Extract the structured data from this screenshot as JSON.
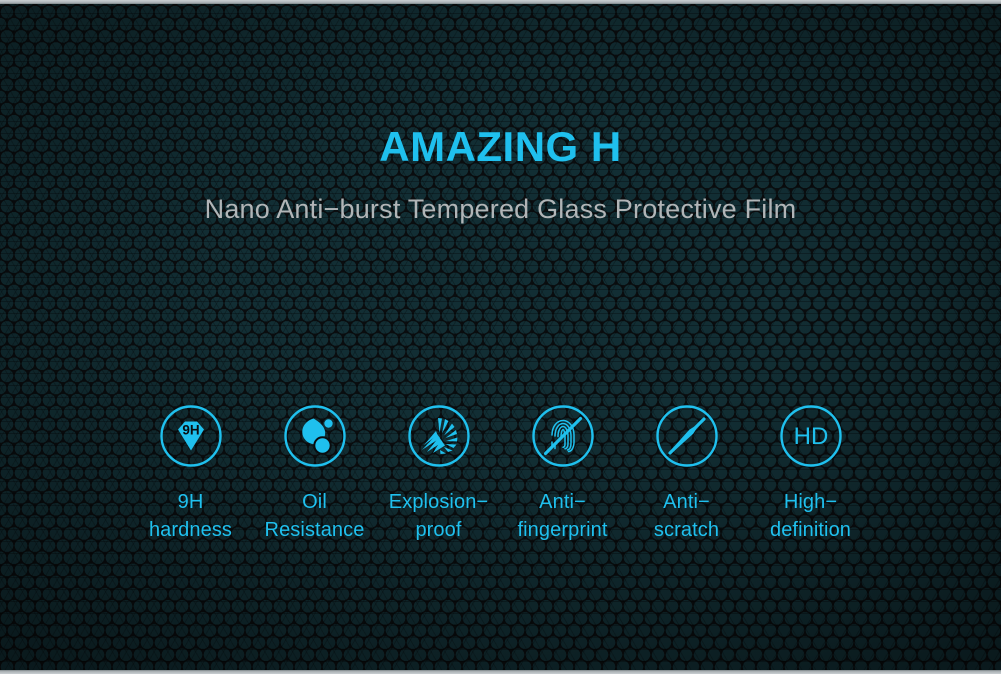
{
  "banner": {
    "headline": "AMAZING H",
    "subhead": "Nano Anti−burst\nTempered Glass Protective Film",
    "subhead_line1": "Nano Anti−burst",
    "subhead_line2": "Tempered Glass Protective Film",
    "colors": {
      "accent_cyan": "#1FC0EE",
      "subhead_gray": "#B1B5B7",
      "background_dark": "#0A0D0F",
      "hex_tint": "#123036",
      "edge_strip": "#AEB5B8"
    }
  },
  "features": [
    {
      "id": "hardness",
      "icon": "diamond-9h-icon",
      "icon_text": "9H",
      "label": "9H\nhardness",
      "label_line1": "9H",
      "label_line2": "hardness"
    },
    {
      "id": "oil-resistance",
      "icon": "oil-droplet-icon",
      "icon_text": "",
      "label": "Oil\nResistance",
      "label_line1": "Oil",
      "label_line2": "Resistance"
    },
    {
      "id": "explosion-proof",
      "icon": "shattered-glass-icon",
      "icon_text": "",
      "label": "Explosion−\nproof",
      "label_line1": "Explosion−",
      "label_line2": "proof"
    },
    {
      "id": "anti-fingerprint",
      "icon": "fingerprint-blocked-icon",
      "icon_text": "",
      "label": "Anti−\nfingerprint",
      "label_line1": "Anti−",
      "label_line2": "fingerprint"
    },
    {
      "id": "anti-scratch",
      "icon": "blade-blocked-icon",
      "icon_text": "",
      "label": "Anti−\nscratch",
      "label_line1": "Anti−",
      "label_line2": "scratch"
    },
    {
      "id": "high-definition",
      "icon": "hd-circle-icon",
      "icon_text": "HD",
      "label": "High−\ndefinition",
      "label_line1": "High−",
      "label_line2": "definition"
    }
  ]
}
